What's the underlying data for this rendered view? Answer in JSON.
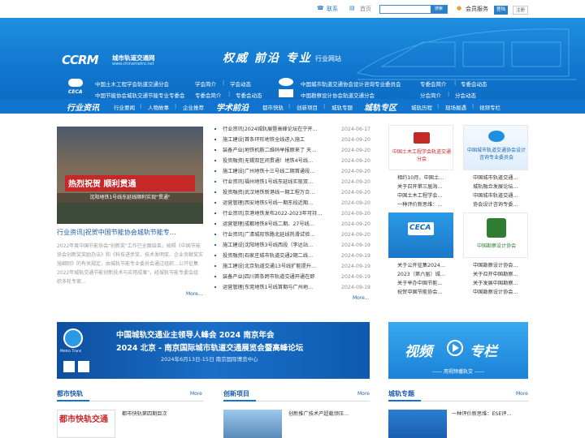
{
  "topbar": {
    "contact": "联系",
    "home": "首页",
    "search_button": "搜索",
    "member_service": "会员服务",
    "login": "登陆",
    "register": "注册"
  },
  "header": {
    "logo_text": "CCRM",
    "logo_cn": "城市轨道交通网",
    "logo_url": "www.chinametro.net",
    "slogan": "权威 前沿 专业",
    "slogan_sub": "行业网站",
    "row1": {
      "org1": "中国土木工程学会轨道交通分会",
      "org1_links": [
        "学会简介",
        "学会动态"
      ],
      "org2": "中国城市轨道交通协会设计咨询专业委员会",
      "org2_links": [
        "专委会简介",
        "专委会动态"
      ]
    },
    "row2": {
      "org1": "中国节能协会城轨交通节能专业专委会",
      "org1_links": [
        "专委会简介",
        "专委会动态"
      ],
      "org2": "中国勘察设计协会轨道交通分会",
      "org2_links": [
        "分会简介",
        "分会动态"
      ]
    }
  },
  "nav": {
    "group1_title": "行业资讯",
    "group1": [
      "行业要闻",
      "人物故事",
      "企业推荐"
    ],
    "group2_title": "学术前沿",
    "group2": [
      "都市快轨",
      "创新项目",
      "城轨专题"
    ],
    "group3_title": "城轨专区",
    "group3": [
      "城轨历程",
      "现场掘遇",
      "视频专栏"
    ]
  },
  "hero": {
    "banner_text": "热烈祝贺 顺利贯通",
    "banner_sub": "沈阳地铁1号线东延线顺利实现\"贯通\"",
    "caption": "行业资讯|祝贺中国节能协会城轨节能专…",
    "summary": "2022年度中国节能协会\"创新奖\"工作已全面结束。按照《中国节能协会创新奖奖励办法》和《科技进步奖、技术发明奖、企业贡献奖实施细则》的有关规定，由城轨节能专业委员会通过组织…公开征集2022年城轨交通节能创新技术与应用成果\"，经城轨节能专委会组织多轮专家…",
    "more": "More..."
  },
  "news": [
    {
      "title": "行业资讯|2024城轨展暨高峰论坛在宁开…",
      "date": "2024-06-17"
    },
    {
      "title": "施工建设|首条环形地铁全线进入施工",
      "date": "2024-09-20"
    },
    {
      "title": "装备产业|地铁机筋二维码举报原来了 天…",
      "date": "2024-09-20"
    },
    {
      "title": "投资融资|无锡双区间贯通！地铁4号线…",
      "date": "2024-09-20"
    },
    {
      "title": "施工建设|广州地铁十三号线二期首通段…",
      "date": "2024-09-20"
    },
    {
      "title": "行业资讯|福州地铁1号线东延线实现双…",
      "date": "2024-09-20"
    },
    {
      "title": "投资融资|武汉地铁新港线一期工程万合…",
      "date": "2024-09-20"
    },
    {
      "title": "运营管理|西安地铁5号线一期东段近期…",
      "date": "2024-09-20"
    },
    {
      "title": "行业资讯|京港地铁发布2022-2023年可持…",
      "date": "2024-09-20"
    },
    {
      "title": "运营管理|成都地铁8号线二期、27号线…",
      "date": "2024-09-20"
    },
    {
      "title": "行业资讯|广清城际铁路北延线热滑试验…",
      "date": "2024-09-20"
    },
    {
      "title": "施工建设|沈阳地铁3号线西段（李达站…",
      "date": "2024-09-19"
    },
    {
      "title": "投资融资|石家庄城市轨道交通2期二线…",
      "date": "2024-09-19"
    },
    {
      "title": "施工建设|北京轨道交通13号线扩能提升…",
      "date": "2024-09-19"
    },
    {
      "title": "装备产业|四川首条跨市轨道交通开通在即",
      "date": "2024-09-19"
    },
    {
      "title": "运营管理|东莞地铁1号线首期与广州地…",
      "date": "2024-09-19"
    }
  ],
  "news_more": "More...",
  "cards": {
    "c1": {
      "title": "中国土木工程学会轨道交通分会",
      "items": [
        "相约10月，中国土…",
        "关于召开第三届海…",
        "中国土木工程学会…",
        "一种评价新思维：…"
      ]
    },
    "c2": {
      "title": "中国城市轨道交通协会设计咨询专业委员会",
      "items": [
        "中国城市轨道交通…",
        "城轨融合发展论坛…",
        "中国城市轨道交通…",
        "协会设计咨询专委…"
      ]
    },
    "c3": {
      "title": "CECA",
      "items": [
        "关于公开征集2024…",
        "2023（第六届）城…",
        "关于举办中国节能…",
        "祝贺中国节能协会…"
      ]
    },
    "c4": {
      "title": "中国勘察设计协会",
      "items": [
        "中国勘察设计协会…",
        "关于召开中国勘察…",
        "关于发展中国勘察…",
        "中国勘察设计协会…"
      ]
    }
  },
  "banner": {
    "line1": "中国城轨交通业主领导人峰会 2024 南京年会",
    "line2": "2024 北京 - 南京国际城市轨道交通展览会暨高峰论坛",
    "line3": "2024年6月13日-15日  南京国际博览中心",
    "brand": "Metro Trans"
  },
  "video": {
    "title1": "视频",
    "title2": "专栏",
    "sub": "—— 用视频播轨交 ——"
  },
  "sections": [
    {
      "title": "都市快轨",
      "more": "More",
      "item": "都市快轨第四期目次",
      "thumb_text": "都市快轨交通"
    },
    {
      "title": "创新项目",
      "more": "More",
      "item": "创新推广技术产超载领压…"
    },
    {
      "title": "城轨专题",
      "more": "More",
      "item": "一种评价新思维：ESE评…"
    }
  ],
  "colors": {
    "primary": "#1175cf",
    "header_blue": "#1f8fe0",
    "link": "#1f5fae",
    "date": "#888888"
  }
}
